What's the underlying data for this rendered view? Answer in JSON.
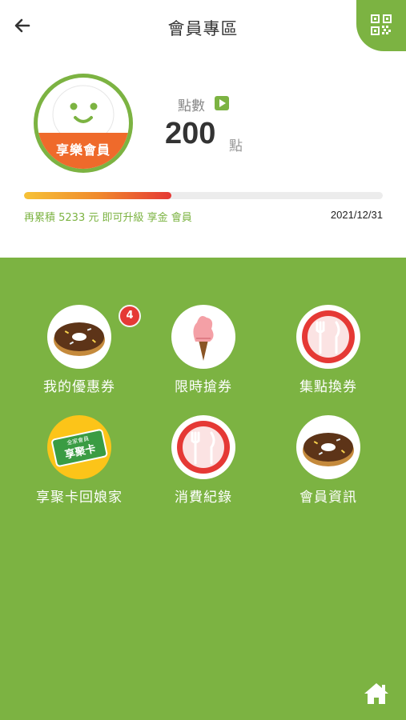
{
  "header": {
    "title": "會員專區"
  },
  "member": {
    "tier_label": "享樂會員",
    "points_label": "點數",
    "points_value": "200",
    "points_unit": "點",
    "progress_fraction": 0.41,
    "upgrade_text": "再累積 5233 元 即可升級 享金 會員",
    "expire_date": "2021/12/31"
  },
  "menu": [
    {
      "label": "我的優惠券",
      "icon": "donut-icon",
      "badge": "4"
    },
    {
      "label": "限時搶券",
      "icon": "ice-cream-icon"
    },
    {
      "label": "集點換券",
      "icon": "plate-cutlery-icon"
    },
    {
      "label": "享聚卡回娘家",
      "icon": "card-icon",
      "card_top": "全家會員",
      "card_text": "享聚卡"
    },
    {
      "label": "消費紀錄",
      "icon": "plate-cutlery-icon"
    },
    {
      "label": "會員資訊",
      "icon": "donut-icon"
    }
  ],
  "colors": {
    "brand_green": "#7cb342",
    "badge_red": "#e53935",
    "tier_orange": "#ef6a2b"
  }
}
